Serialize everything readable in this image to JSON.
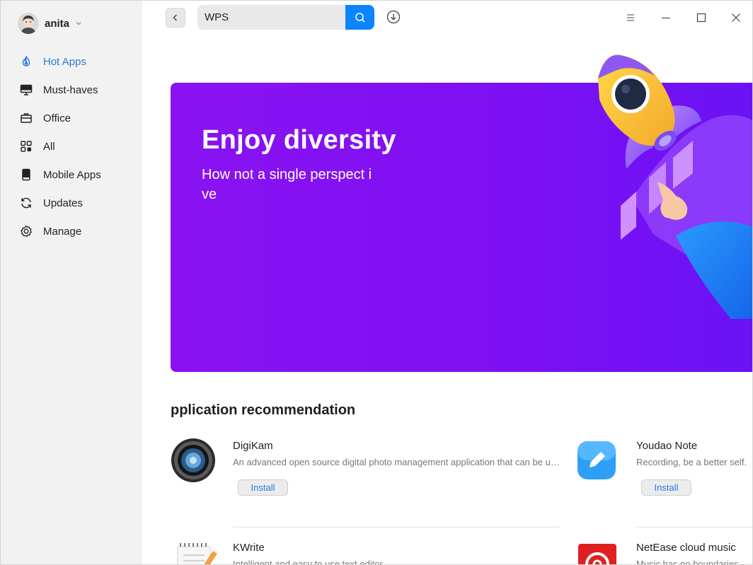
{
  "user": {
    "name": "anita"
  },
  "sidebar": {
    "items": [
      {
        "label": "Hot Apps",
        "icon": "flame-icon",
        "active": true
      },
      {
        "label": "Must-haves",
        "icon": "monitor-icon"
      },
      {
        "label": "Office",
        "icon": "briefcase-icon"
      },
      {
        "label": "All",
        "icon": "grid-icon"
      },
      {
        "label": "Mobile Apps",
        "icon": "phone-icon"
      },
      {
        "label": "Updates",
        "icon": "refresh-icon"
      },
      {
        "label": "Manage",
        "icon": "gear-icon"
      }
    ]
  },
  "search": {
    "value": "WPS"
  },
  "banner": {
    "title": "Enjoy diversity",
    "subtitle": "How not a single perspect ive"
  },
  "section": {
    "title": "pplication recommendation"
  },
  "apps": [
    {
      "name": "DigiKam",
      "description": "An advanced open source digital photo management application that can be use…",
      "install_label": "Install"
    },
    {
      "name": "Youdao Note",
      "description": "Recording, be a better self.",
      "install_label": "Install"
    },
    {
      "name": "KWrite",
      "description": "Intelligent and easy to use text editor"
    },
    {
      "name": "NetEase cloud music",
      "description": "Music has no boundaries, hea"
    }
  ],
  "colors": {
    "accent": "#0a84ff",
    "active_nav": "#2a7bd8",
    "banner": "#8a12f2",
    "sidebar": "#f2f2f2"
  }
}
